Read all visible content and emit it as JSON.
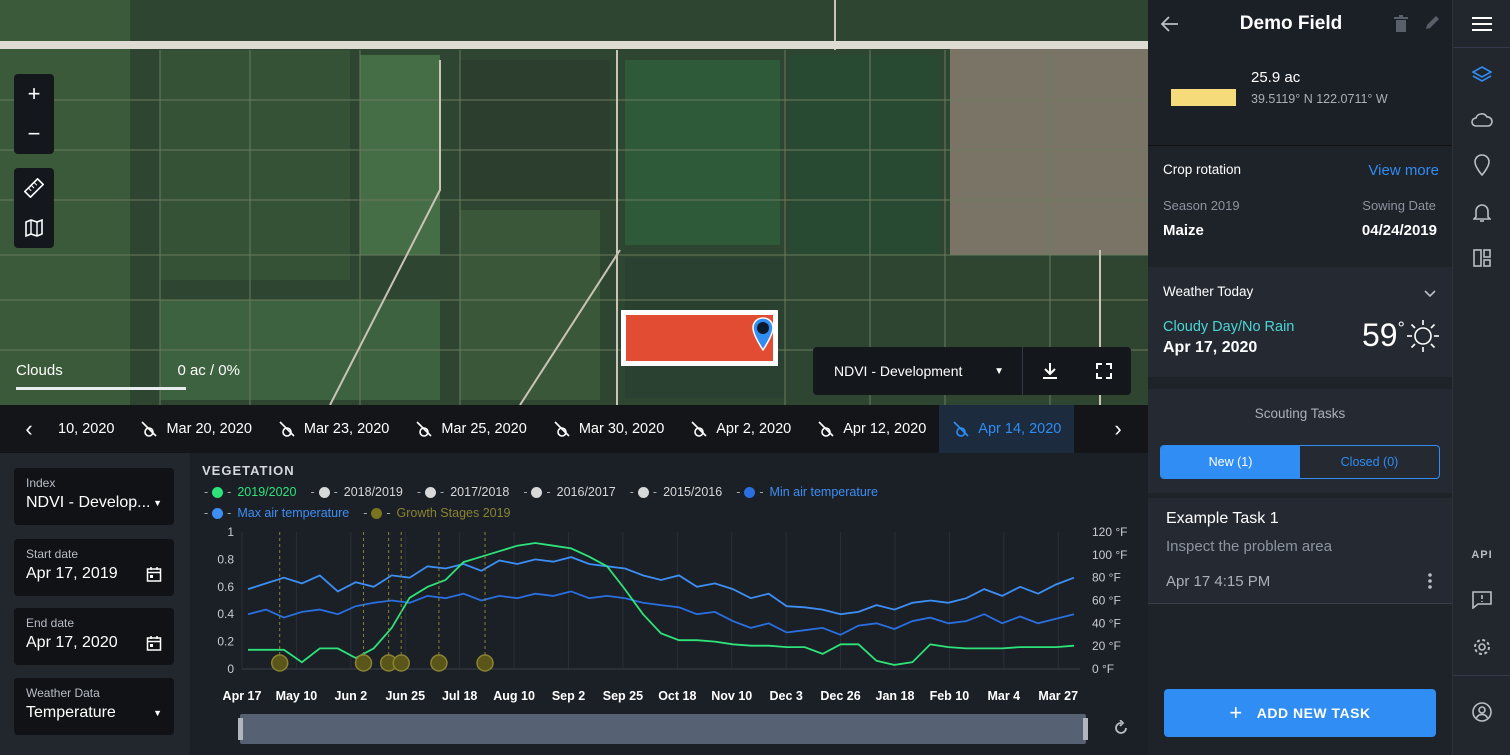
{
  "map": {
    "clouds_label": "Clouds",
    "clouds_value": "0 ac / 0%",
    "layer_select": "NDVI - Development",
    "zoom_in": "+",
    "zoom_out": "−"
  },
  "dates": [
    "10, 2020",
    "Mar 20, 2020",
    "Mar 23, 2020",
    "Mar 25, 2020",
    "Mar 30, 2020",
    "Apr 2, 2020",
    "Apr 12, 2020",
    "Apr 14, 2020"
  ],
  "selected_date": "Apr 14, 2020",
  "left_panel": {
    "index_label": "Index",
    "index_value": "NDVI - Develop...",
    "start_label": "Start date",
    "start_value": "Apr 17, 2019",
    "end_label": "End date",
    "end_value": "Apr 17, 2020",
    "weather_label": "Weather Data",
    "weather_value": "Temperature"
  },
  "chart_data": {
    "type": "line",
    "title": "VEGETATION",
    "legend": [
      {
        "name": "2019/2020",
        "color": "#2de37a"
      },
      {
        "name": "2018/2019",
        "color": "#d8d8d8"
      },
      {
        "name": "2017/2018",
        "color": "#d8d8d8"
      },
      {
        "name": "2016/2017",
        "color": "#d8d8d8"
      },
      {
        "name": "2015/2016",
        "color": "#d8d8d8"
      },
      {
        "name": "Min air temperature",
        "color": "#2a6fe0"
      },
      {
        "name": "Max air temperature",
        "color": "#3d8ff5"
      },
      {
        "name": "Growth Stages 2019",
        "color": "#7a7420"
      }
    ],
    "x_ticks": [
      "Apr 17",
      "May 10",
      "Jun 2",
      "Jun 25",
      "Jul 18",
      "Aug 10",
      "Sep 2",
      "Sep 25",
      "Oct 18",
      "Nov 10",
      "Dec 3",
      "Dec 26",
      "Jan 18",
      "Feb 10",
      "Mar 4",
      "Mar 27"
    ],
    "y_left_ticks": [
      "0",
      "0.2",
      "0.4",
      "0.6",
      "0.8",
      "1"
    ],
    "y_right_ticks": [
      "0 °F",
      "20 °F",
      "40 °F",
      "60 °F",
      "80 °F",
      "100 °F",
      "120 °F"
    ],
    "ylim_left": [
      0,
      1
    ],
    "ylim_right": [
      0,
      120
    ],
    "ndvi_2019_2020": [
      0.14,
      0.14,
      0.14,
      0.05,
      0.15,
      0.15,
      0.08,
      0.15,
      0.3,
      0.52,
      0.6,
      0.65,
      0.78,
      0.82,
      0.86,
      0.9,
      0.92,
      0.9,
      0.88,
      0.82,
      0.75,
      0.58,
      0.4,
      0.26,
      0.21,
      0.21,
      0.2,
      0.18,
      0.17,
      0.17,
      0.16,
      0.16,
      0.11,
      0.18,
      0.18,
      0.06,
      0.03,
      0.05,
      0.18,
      0.16,
      0.15,
      0.15,
      0.15,
      0.16,
      0.16,
      0.16,
      0.17
    ],
    "max_temp": [
      70,
      75,
      80,
      75,
      82,
      68,
      76,
      72,
      82,
      80,
      90,
      88,
      92,
      86,
      95,
      92,
      96,
      94,
      98,
      92,
      90,
      88,
      82,
      78,
      82,
      72,
      75,
      70,
      62,
      66,
      55,
      54,
      52,
      48,
      50,
      56,
      52,
      58,
      60,
      58,
      62,
      70,
      64,
      72,
      66,
      74,
      80
    ],
    "min_temp": [
      48,
      52,
      45,
      50,
      52,
      48,
      55,
      58,
      60,
      58,
      64,
      62,
      66,
      60,
      64,
      62,
      66,
      64,
      68,
      62,
      64,
      62,
      58,
      56,
      54,
      48,
      50,
      42,
      36,
      40,
      32,
      34,
      36,
      30,
      38,
      40,
      35,
      42,
      45,
      40,
      42,
      48,
      40,
      46,
      40,
      44,
      48
    ],
    "growth_stage_markers": [
      "May 1",
      "Jun 5",
      "Jun 15",
      "Jun 20",
      "Jul 10",
      "Aug 1"
    ]
  },
  "field": {
    "name": "Demo Field",
    "area": "25.9 ac",
    "coords": "39.5119° N 122.0711° W",
    "color": "#f5db7a"
  },
  "crop_rotation": {
    "title": "Crop rotation",
    "link": "View more",
    "season_label": "Season 2019",
    "season_value": "Maize",
    "sowing_label": "Sowing Date",
    "sowing_value": "04/24/2019"
  },
  "weather": {
    "title": "Weather Today",
    "condition": "Cloudy Day/No Rain",
    "date": "Apr 17, 2020",
    "temp": "59",
    "degree": "°"
  },
  "scouting": {
    "title": "Scouting Tasks",
    "tab_new": "New (1)",
    "tab_closed": "Closed (0)",
    "task_title": "Example Task 1",
    "task_desc": "Inspect the problem area",
    "task_time": "Apr 17 4:15 PM",
    "add_button": "ADD NEW TASK"
  },
  "iconbar": {
    "api_label": "API"
  }
}
